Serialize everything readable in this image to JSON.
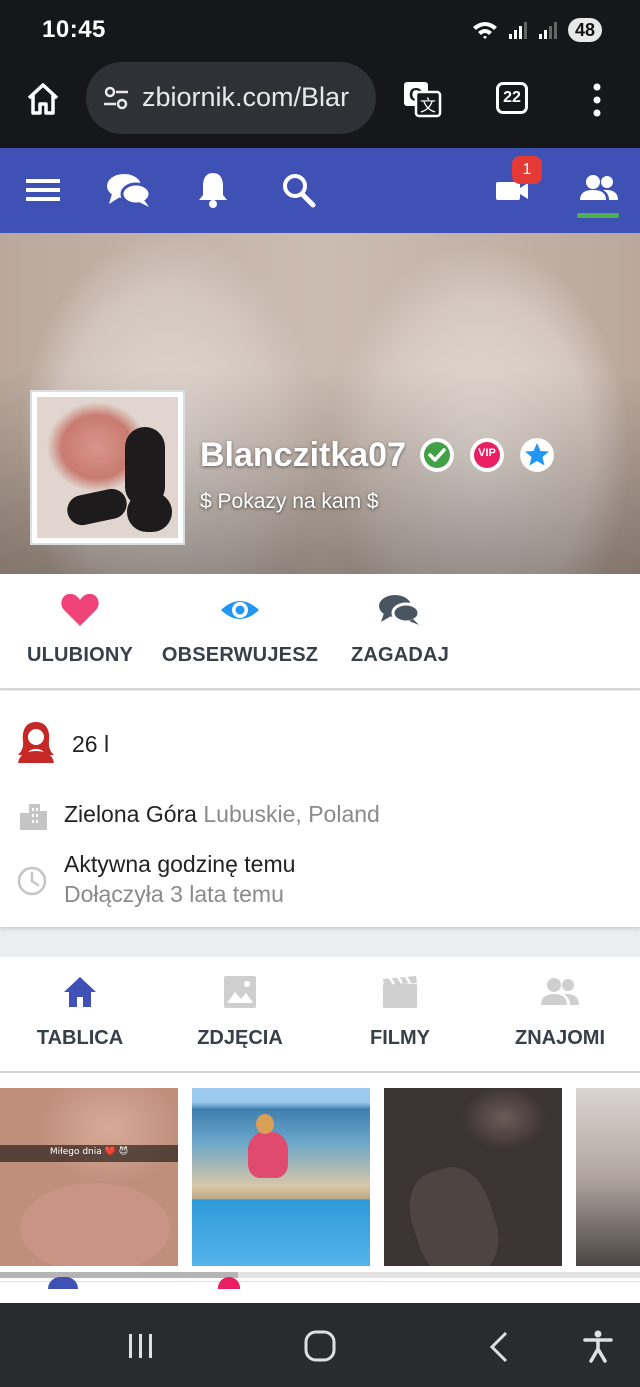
{
  "status_bar": {
    "time": "10:45",
    "battery": "48"
  },
  "browser": {
    "url": "zbiornik.com/Blar",
    "tab_count": "22"
  },
  "site_nav": {
    "notification_count": "1"
  },
  "profile": {
    "username": "Blanczitka07",
    "tagline": "$ Pokazy na kam $",
    "vip_badge": "VIP"
  },
  "actions": [
    {
      "label": "ULUBIONY",
      "icon": "heart-icon",
      "color": "#f0437a"
    },
    {
      "label": "OBSERWUJESZ",
      "icon": "eye-icon",
      "color": "#2196f3"
    },
    {
      "label": "ZAGADAJ",
      "icon": "chat-icon",
      "color": "#4a5562"
    }
  ],
  "info": {
    "age": "26 l",
    "city": "Zielona Góra",
    "region": "Lubuskie, Poland",
    "activity": "Aktywna godzinę temu",
    "joined": "Dołączyła 3 lata temu"
  },
  "tabs": [
    {
      "label": "TABLICA",
      "icon": "home-icon",
      "active": true
    },
    {
      "label": "ZDJĘCIA",
      "icon": "image-icon",
      "active": false
    },
    {
      "label": "FILMY",
      "icon": "film-icon",
      "active": false
    },
    {
      "label": "ZNAJOMI",
      "icon": "friends-icon",
      "active": false
    }
  ],
  "thumbnails": [
    {
      "caption": "Miłego dnia ❤️ 😈"
    },
    {
      "caption": ""
    },
    {
      "caption": ""
    },
    {
      "caption": ""
    }
  ],
  "colors": {
    "brand": "#3f51b5",
    "accent_green": "#4caf50",
    "badge_red": "#e53935"
  }
}
